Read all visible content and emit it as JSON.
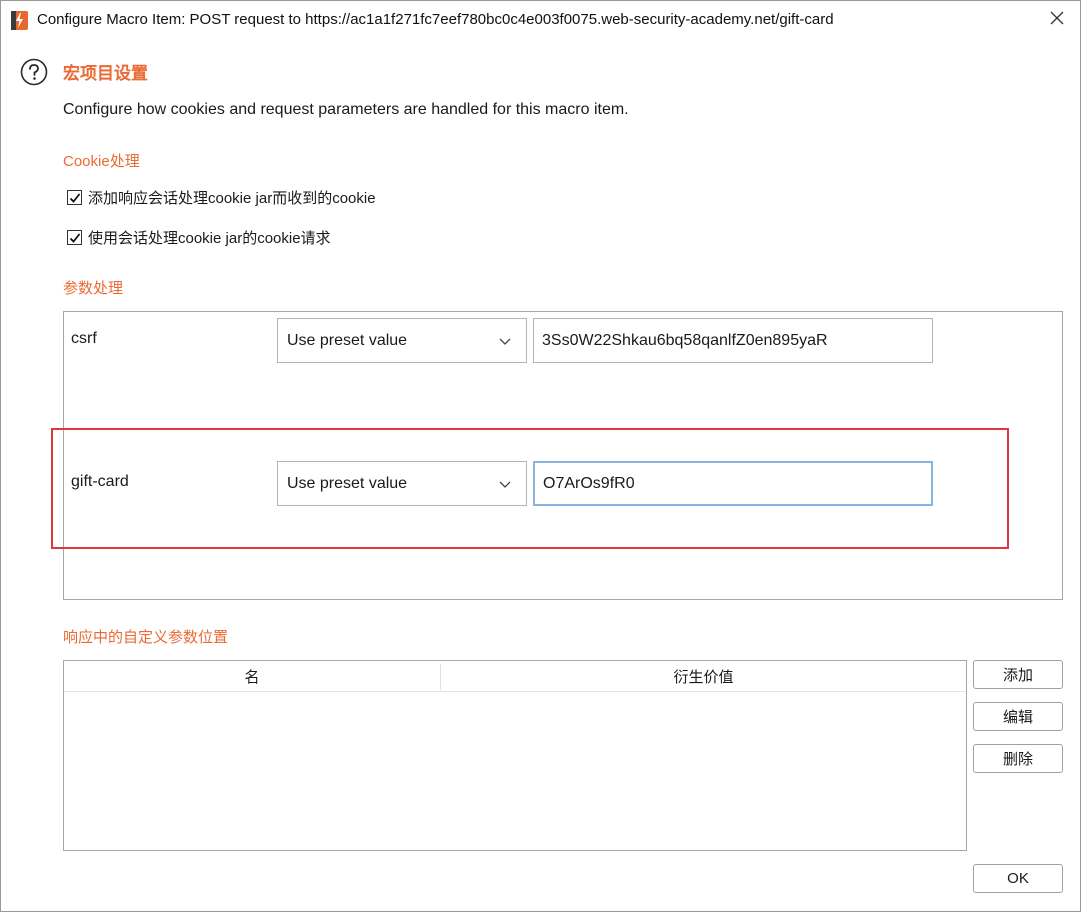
{
  "window": {
    "title": "Configure Macro Item: POST request to https://ac1a1f271fc7eef780bc0c4e003f0075.web-security-academy.net/gift-card",
    "app_icon": "burp-suite-icon",
    "close_icon": "close-icon"
  },
  "header": {
    "help_icon": "help-icon",
    "title": "宏项目设置",
    "description": "Configure how cookies and request parameters are handled for this macro item."
  },
  "cookie_section": {
    "label": "Cookie处理",
    "options": [
      {
        "label": "添加响应会话处理cookie jar而收到的cookie",
        "checked": true
      },
      {
        "label": "使用会话处理cookie jar的cookie请求",
        "checked": true
      }
    ]
  },
  "param_section": {
    "label": "参数处理",
    "params": [
      {
        "name": "csrf",
        "mode": "Use preset value",
        "value": "3Ss0W22Shkau6bq58qanlfZ0en895yaR"
      },
      {
        "name": "gift-card",
        "mode": "Use preset value",
        "value": "O7ArOs9fR0"
      }
    ]
  },
  "custom_section": {
    "label": "响应中的自定义参数位置",
    "columns": [
      "名",
      "衍生价值"
    ],
    "rows": []
  },
  "buttons": {
    "add": "添加",
    "edit": "编辑",
    "delete": "删除",
    "ok": "OK"
  },
  "colors": {
    "accent": "#ea6a33",
    "highlight": "#e0383a",
    "focus_border": "#88b4df"
  }
}
